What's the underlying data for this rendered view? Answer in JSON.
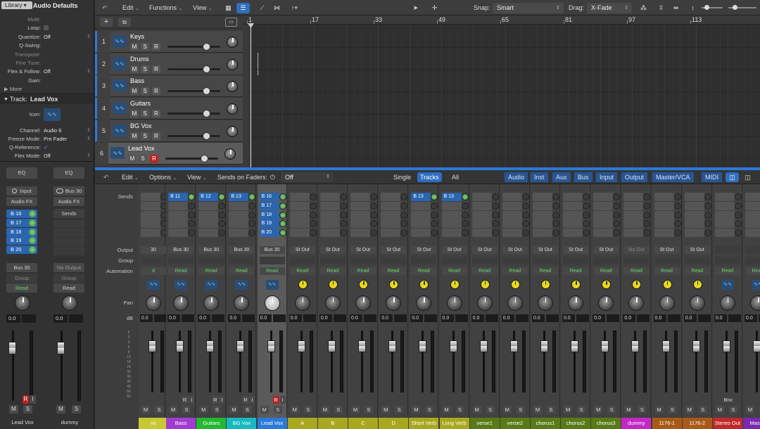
{
  "inspector": {
    "library_tab": "Library",
    "region_title": "Audio Defaults",
    "rows": [
      {
        "label": "Mute:",
        "value": "",
        "dim": true
      },
      {
        "label": "Loop:",
        "value": "",
        "dim": false
      },
      {
        "label": "Quantize:",
        "value": "Off",
        "dim": false
      },
      {
        "label": "Q-Swing:",
        "value": "",
        "dim": false
      },
      {
        "label": "Transpose:",
        "value": "",
        "dim": true
      },
      {
        "label": "Fine Tune:",
        "value": "",
        "dim": true
      },
      {
        "label": "Flex & Follow:",
        "value": "Off",
        "dim": false
      },
      {
        "label": "Gain:",
        "value": "",
        "dim": false
      }
    ],
    "more": "More",
    "track_label": "Track:",
    "track_name": "Lead Vox",
    "track_rows": [
      {
        "label": "Icon:",
        "value": ""
      },
      {
        "label": "Channel:",
        "value": "Audio 6"
      },
      {
        "label": "Freeze Mode:",
        "value": "Pre Fader"
      },
      {
        "label": "Q-Reference:",
        "value": "✓"
      },
      {
        "label": "Flex Mode:",
        "value": "Off"
      }
    ],
    "left_strip": {
      "eq": "EQ",
      "input": "Input",
      "audio_fx": "Audio FX",
      "sends": [
        "B 16",
        "B 17",
        "B 18",
        "B 19",
        "B 20"
      ],
      "output": "Bus 30",
      "group": "Group",
      "automation": "Read",
      "db": "0.0",
      "name": "Lead Vox",
      "m": "M",
      "s": "S",
      "r": "R",
      "i": "I"
    },
    "right_strip": {
      "eq": "EQ",
      "input": "Bus 30",
      "audio_fx": "Audio FX",
      "sends": "Sends",
      "output": "No Output",
      "group": "Group",
      "automation": "Read",
      "db": "0.0",
      "name": "dummy",
      "m": "M",
      "s": "S"
    }
  },
  "tracks": {
    "menus": {
      "edit": "Edit",
      "functions": "Functions",
      "view": "View"
    },
    "snap_label": "Snap:",
    "snap_value": "Smart",
    "drag_label": "Drag:",
    "drag_value": "X-Fade",
    "ruler": [
      "1",
      "17",
      "33",
      "49",
      "65",
      "81",
      "97",
      "113"
    ],
    "list": [
      {
        "num": "1",
        "name": "Keys"
      },
      {
        "num": "2",
        "name": "Drums"
      },
      {
        "num": "3",
        "name": "Bass"
      },
      {
        "num": "4",
        "name": "Guitars"
      },
      {
        "num": "5",
        "name": "BG Vox"
      },
      {
        "num": "6",
        "name": "Lead Vox"
      }
    ],
    "m": "M",
    "s": "S",
    "r": "R"
  },
  "mixer": {
    "menus": {
      "edit": "Edit",
      "options": "Options",
      "view": "View",
      "sends_on_faders": "Sends on Faders:",
      "off": "Off"
    },
    "views": {
      "single": "Single",
      "tracks": "Tracks",
      "all": "All"
    },
    "filters": [
      "Audio",
      "Inst",
      "Aux",
      "Bus",
      "Input",
      "Output",
      "Master/VCA",
      "MIDI"
    ],
    "row_labels": {
      "sends": "Sends",
      "output": "Output",
      "group": "Group",
      "automation": "Automation",
      "pan": "Pan",
      "db": "dB"
    },
    "strips": [
      {
        "name": "ns",
        "color": "#c8c832",
        "sends": [],
        "output": "30",
        "auto": "d",
        "icon": "wave",
        "rec": false
      },
      {
        "name": "Bass",
        "color": "#a23cd0",
        "sends": [
          "B 11"
        ],
        "output": "Bus 30",
        "auto": "Read",
        "icon": "wave",
        "rec": true
      },
      {
        "name": "Guitars",
        "color": "#22b832",
        "sends": [
          "B 12"
        ],
        "output": "Bus 30",
        "auto": "Read",
        "icon": "wave",
        "rec": true
      },
      {
        "name": "BG Vox",
        "color": "#18b8c0",
        "sends": [
          "B 13"
        ],
        "output": "Bus 30",
        "auto": "Read",
        "icon": "wave",
        "rec": true
      },
      {
        "name": "Lead Vox",
        "color": "#2a7ad8",
        "sends": [
          "B 16",
          "B 17",
          "B 18",
          "B 19",
          "B 20"
        ],
        "output": "Bus 30",
        "auto": "Read",
        "icon": "wave",
        "rec": true,
        "selected": true
      },
      {
        "name": "A",
        "color": "#a8a820",
        "sends": [],
        "output": "St Out",
        "auto": "Read",
        "icon": "yellow"
      },
      {
        "name": "B",
        "color": "#a8a820",
        "sends": [],
        "output": "St Out",
        "auto": "Read",
        "icon": "yellow"
      },
      {
        "name": "C",
        "color": "#a8a820",
        "sends": [],
        "output": "St Out",
        "auto": "Read",
        "icon": "yellow"
      },
      {
        "name": "D",
        "color": "#a8a820",
        "sends": [],
        "output": "St Out",
        "auto": "Read",
        "icon": "yellow"
      },
      {
        "name": "Short Verb",
        "color": "#a8a820",
        "sends": [
          "B 13"
        ],
        "output": "St Out",
        "auto": "Read",
        "icon": "yellow"
      },
      {
        "name": "Long Verb",
        "color": "#a8a820",
        "sends": [
          "B 13"
        ],
        "output": "St Out",
        "auto": "Read",
        "icon": "yellow"
      },
      {
        "name": "verse1",
        "color": "#5a7a18",
        "sends": [],
        "output": "St Out",
        "auto": "Read",
        "icon": "yellow"
      },
      {
        "name": "verse2",
        "color": "#5a7a18",
        "sends": [],
        "output": "St Out",
        "auto": "Read",
        "icon": "yellow"
      },
      {
        "name": "chorus1",
        "color": "#5a7a18",
        "sends": [],
        "output": "St Out",
        "auto": "Read",
        "icon": "yellow"
      },
      {
        "name": "chorus2",
        "color": "#5a7a18",
        "sends": [],
        "output": "St Out",
        "auto": "Read",
        "icon": "yellow"
      },
      {
        "name": "chorus3",
        "color": "#5a7a18",
        "sends": [],
        "output": "St Out",
        "auto": "Read",
        "icon": "yellow"
      },
      {
        "name": "dummy",
        "color": "#c428c4",
        "sends": [],
        "output": "No Out",
        "auto": "Read",
        "icon": "yellow"
      },
      {
        "name": "1176-1",
        "color": "#a85a18",
        "sends": [],
        "output": "St Out",
        "auto": "Read",
        "icon": "yellow"
      },
      {
        "name": "1176-2",
        "color": "#a85a18",
        "sends": [],
        "output": "St Out",
        "auto": "Read",
        "icon": "yellow"
      },
      {
        "name": "Stereo Out",
        "color": "#c02a2a",
        "sends": [],
        "output": "",
        "auto": "Read",
        "icon": "wave",
        "bnc": "Bnc"
      },
      {
        "name": "Master",
        "color": "#7a2ab0",
        "sends": [],
        "output": "",
        "auto": "Read",
        "icon": "wave"
      }
    ],
    "db_value": "0.0",
    "m": "M",
    "s": "S",
    "r": "R",
    "i": "I"
  }
}
